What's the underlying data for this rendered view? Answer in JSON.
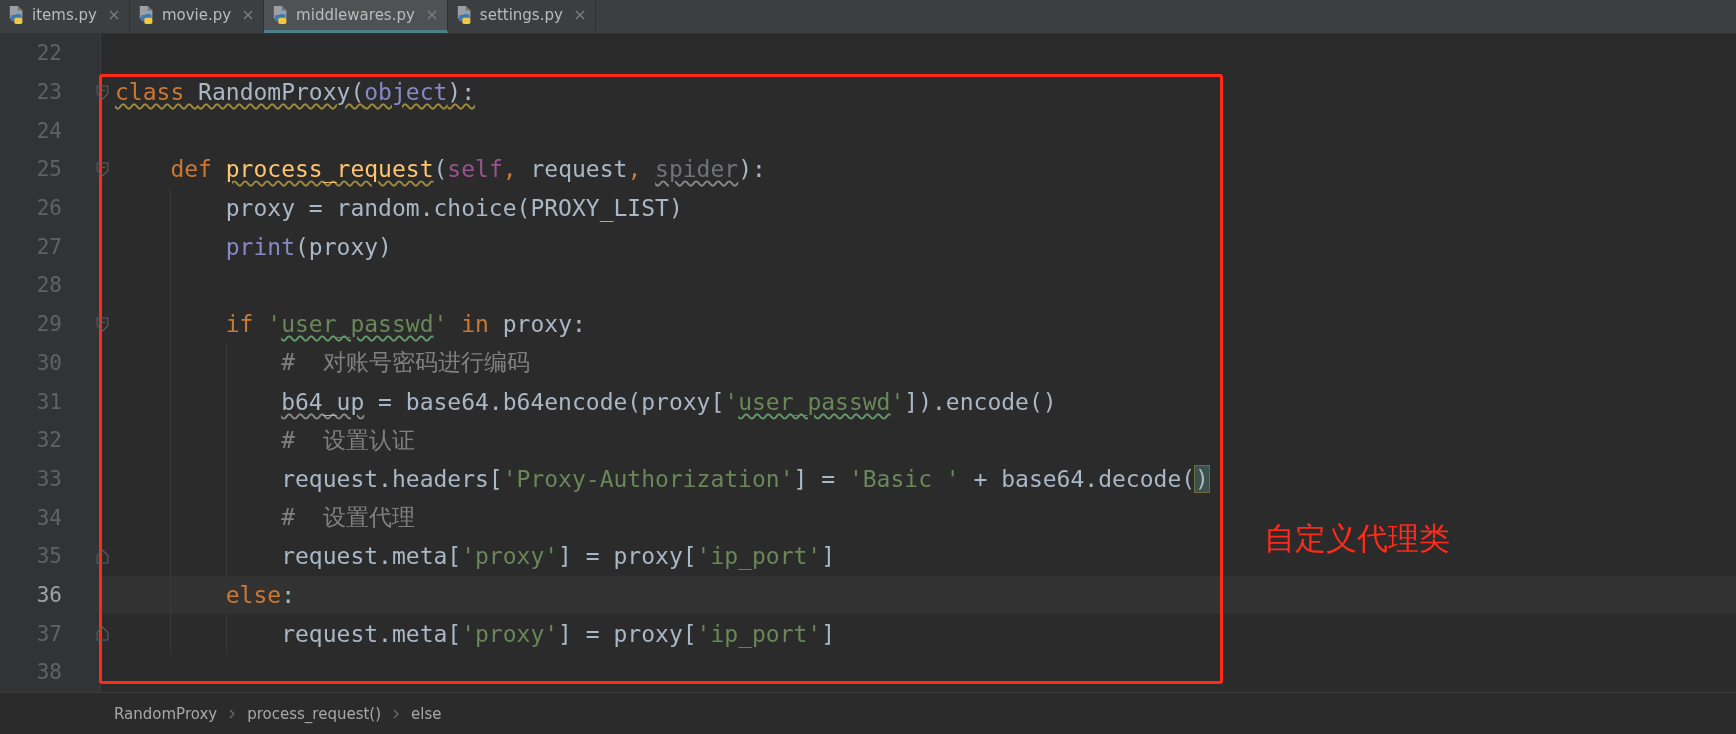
{
  "tabs": [
    {
      "label": "items.py",
      "selected": false
    },
    {
      "label": "movie.py",
      "selected": false
    },
    {
      "label": "middlewares.py",
      "selected": true
    },
    {
      "label": "settings.py",
      "selected": false
    }
  ],
  "editor": {
    "lines": [
      {
        "number": "22",
        "current": false
      },
      {
        "number": "23",
        "current": false,
        "fold_start": true,
        "tokens": [
          {
            "kind": "keyword",
            "text": "class ",
            "warning": true
          },
          {
            "kind": "plain",
            "text": "RandomProxy(",
            "warning": true
          },
          {
            "kind": "builtin",
            "text": "object",
            "warning": true
          },
          {
            "kind": "plain",
            "text": "):",
            "warning": true
          }
        ],
        "children": [
          {
            "number": "24",
            "current": false
          },
          {
            "number": "25",
            "current": false,
            "fold_start": true,
            "tokens": [
              {
                "kind": "keyword",
                "text": "def "
              },
              {
                "kind": "function",
                "text": "process_request",
                "warning": true
              },
              {
                "kind": "plain",
                "text": "("
              },
              {
                "kind": "self",
                "text": "self"
              },
              {
                "kind": "keyword",
                "text": ", "
              },
              {
                "kind": "plain",
                "text": "request"
              },
              {
                "kind": "keyword",
                "text": ", "
              },
              {
                "kind": "unused",
                "text": "spider",
                "unused_mark": true
              },
              {
                "kind": "plain",
                "text": "):"
              }
            ],
            "children": [
              {
                "number": "26",
                "current": false,
                "tokens": [
                  {
                    "kind": "plain",
                    "text": "proxy = random.choice(PROXY_LIST)"
                  }
                ]
              },
              {
                "number": "27",
                "current": false,
                "tokens": [
                  {
                    "kind": "builtin",
                    "text": "print"
                  },
                  {
                    "kind": "plain",
                    "text": "(proxy)"
                  }
                ]
              },
              {
                "number": "28",
                "current": false
              },
              {
                "number": "29",
                "current": false,
                "fold_start": true,
                "tokens": [
                  {
                    "kind": "keyword",
                    "text": "if "
                  },
                  {
                    "kind": "string",
                    "text": "'"
                  },
                  {
                    "kind": "string",
                    "text": "user_passwd",
                    "typo": true
                  },
                  {
                    "kind": "string",
                    "text": "' "
                  },
                  {
                    "kind": "keyword",
                    "text": "in "
                  },
                  {
                    "kind": "plain",
                    "text": "proxy:"
                  }
                ],
                "children": [
                  {
                    "number": "30",
                    "current": false,
                    "tokens": [
                      {
                        "kind": "comment",
                        "text": "#  对账号密码进行编码"
                      }
                    ]
                  },
                  {
                    "number": "31",
                    "current": false,
                    "tokens": [
                      {
                        "kind": "plain",
                        "text": "b64_up",
                        "unused_mark": true
                      },
                      {
                        "kind": "plain",
                        "text": " = base64.b64encode(proxy["
                      },
                      {
                        "kind": "string",
                        "text": "'"
                      },
                      {
                        "kind": "string",
                        "text": "user_passwd",
                        "typo": true
                      },
                      {
                        "kind": "string",
                        "text": "'"
                      },
                      {
                        "kind": "plain",
                        "text": "]).encode()"
                      }
                    ]
                  },
                  {
                    "number": "32",
                    "current": false,
                    "tokens": [
                      {
                        "kind": "comment",
                        "text": "#  设置认证"
                      }
                    ]
                  },
                  {
                    "number": "33",
                    "current": false,
                    "tokens": [
                      {
                        "kind": "plain",
                        "text": "request.headers["
                      },
                      {
                        "kind": "string",
                        "text": "'Proxy-Authorization'"
                      },
                      {
                        "kind": "plain",
                        "text": "] = "
                      },
                      {
                        "kind": "string",
                        "text": "'Basic '"
                      },
                      {
                        "kind": "plain",
                        "text": " + base64.decode("
                      },
                      {
                        "kind": "plain",
                        "text": ")",
                        "matched": true
                      }
                    ]
                  },
                  {
                    "number": "34",
                    "current": false,
                    "tokens": [
                      {
                        "kind": "comment",
                        "text": "#  设置代理"
                      }
                    ]
                  },
                  {
                    "number": "35",
                    "current": false,
                    "fold_end": true,
                    "tokens": [
                      {
                        "kind": "plain",
                        "text": "request.meta["
                      },
                      {
                        "kind": "string",
                        "text": "'proxy'"
                      },
                      {
                        "kind": "plain",
                        "text": "] = proxy["
                      },
                      {
                        "kind": "string",
                        "text": "'ip_port'"
                      },
                      {
                        "kind": "plain",
                        "text": "]"
                      }
                    ]
                  }
                ]
              },
              {
                "number": "36",
                "current": true,
                "tokens": [
                  {
                    "kind": "keyword",
                    "text": "else"
                  },
                  {
                    "kind": "plain",
                    "text": ":"
                  }
                ],
                "children": [
                  {
                    "number": "37",
                    "current": false,
                    "fold_end": true,
                    "tokens": [
                      {
                        "kind": "plain",
                        "text": "request.meta["
                      },
                      {
                        "kind": "string",
                        "text": "'proxy'"
                      },
                      {
                        "kind": "plain",
                        "text": "] = proxy["
                      },
                      {
                        "kind": "string",
                        "text": "'ip_port'"
                      },
                      {
                        "kind": "plain",
                        "text": "]"
                      }
                    ]
                  }
                ]
              }
            ]
          }
        ]
      },
      {
        "number": "38",
        "current": false
      }
    ]
  },
  "annotation": {
    "label": "自定义代理类"
  },
  "breadcrumb": [
    "RandomProxy",
    "process_request()",
    "else"
  ]
}
